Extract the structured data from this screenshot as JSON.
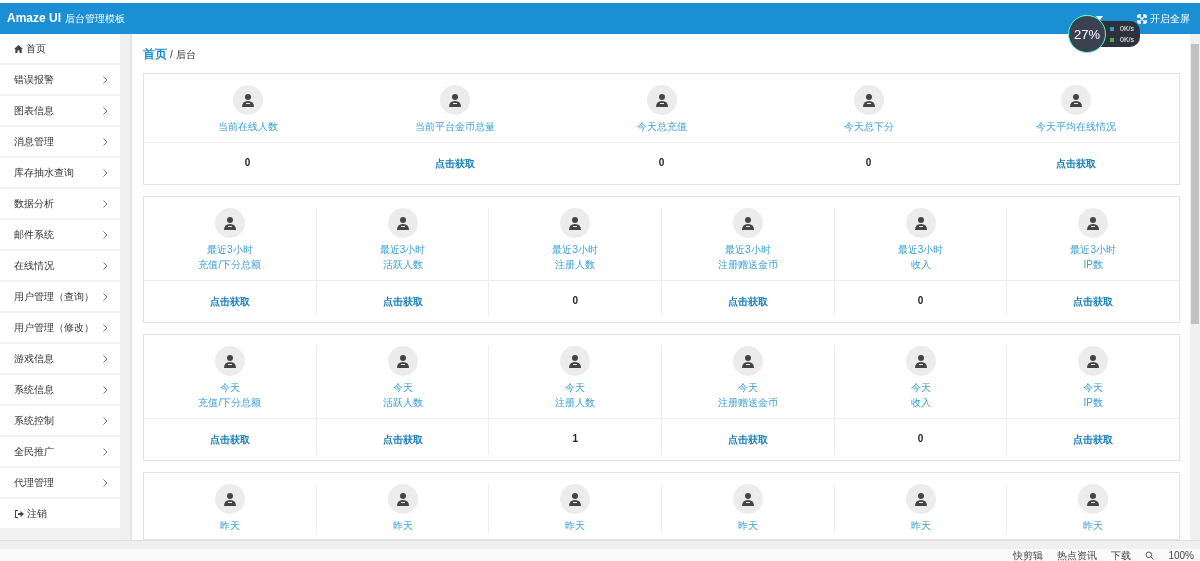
{
  "header": {
    "brand": "Amaze UI",
    "subtitle": "后台管理模板",
    "fullscreen": "开启全屏"
  },
  "speed_widget": {
    "percent": "27%",
    "upload": "0K/s",
    "download": "0K/s"
  },
  "sidebar": {
    "items": [
      {
        "label": "首页",
        "kind": "home",
        "selected": false
      },
      {
        "label": "错误报警",
        "kind": "menu"
      },
      {
        "label": "图表信息",
        "kind": "menu"
      },
      {
        "label": "消息管理",
        "kind": "menu"
      },
      {
        "label": "库存抽水查询",
        "kind": "menu"
      },
      {
        "label": "数据分析",
        "kind": "menu"
      },
      {
        "label": "邮件系统",
        "kind": "menu"
      },
      {
        "label": "在线情况",
        "kind": "menu"
      },
      {
        "label": "用户管理（查询）",
        "kind": "menu"
      },
      {
        "label": "用户管理（修改）",
        "kind": "menu"
      },
      {
        "label": "游戏信息",
        "kind": "menu"
      },
      {
        "label": "系统信息",
        "kind": "menu"
      },
      {
        "label": "系统控制",
        "kind": "menu"
      },
      {
        "label": "全民推广",
        "kind": "menu"
      },
      {
        "label": "代理管理",
        "kind": "menu"
      },
      {
        "label": "注销",
        "kind": "logout"
      }
    ]
  },
  "breadcrumb": {
    "current": "首页",
    "parent": "/ 后台"
  },
  "sections": [
    {
      "cards": [
        {
          "lines": [
            "当前在线人数"
          ],
          "value": {
            "kind": "number",
            "text": "0"
          }
        },
        {
          "lines": [
            "当前平台金币总量"
          ],
          "value": {
            "kind": "link",
            "text": "点击获取"
          }
        },
        {
          "lines": [
            "今天总充值"
          ],
          "value": {
            "kind": "number",
            "text": "0"
          }
        },
        {
          "lines": [
            "今天总下分"
          ],
          "value": {
            "kind": "number",
            "text": "0"
          }
        },
        {
          "lines": [
            "今天平均在线情况"
          ],
          "value": {
            "kind": "link",
            "text": "点击获取"
          }
        }
      ]
    },
    {
      "cards": [
        {
          "lines": [
            "最近3小时",
            "充值/下分总额"
          ],
          "value": {
            "kind": "link",
            "text": "点击获取"
          }
        },
        {
          "lines": [
            "最近3小时",
            "活跃人数"
          ],
          "value": {
            "kind": "link",
            "text": "点击获取"
          }
        },
        {
          "lines": [
            "最近3小时",
            "注册人数"
          ],
          "value": {
            "kind": "number",
            "text": "0"
          }
        },
        {
          "lines": [
            "最近3小时",
            "注册赠送金币"
          ],
          "value": {
            "kind": "link",
            "text": "点击获取"
          }
        },
        {
          "lines": [
            "最近3小时",
            "收入"
          ],
          "value": {
            "kind": "number",
            "text": "0"
          }
        },
        {
          "lines": [
            "最近3小时",
            "IP数"
          ],
          "value": {
            "kind": "link",
            "text": "点击获取"
          }
        }
      ]
    },
    {
      "cards": [
        {
          "lines": [
            "今天",
            "充值/下分总额"
          ],
          "value": {
            "kind": "link",
            "text": "点击获取"
          }
        },
        {
          "lines": [
            "今天",
            "活跃人数"
          ],
          "value": {
            "kind": "link",
            "text": "点击获取"
          }
        },
        {
          "lines": [
            "今天",
            "注册人数"
          ],
          "value": {
            "kind": "number",
            "text": "1"
          }
        },
        {
          "lines": [
            "今天",
            "注册赠送金币"
          ],
          "value": {
            "kind": "link",
            "text": "点击获取"
          }
        },
        {
          "lines": [
            "今天",
            "收入"
          ],
          "value": {
            "kind": "number",
            "text": "0"
          }
        },
        {
          "lines": [
            "今天",
            "IP数"
          ],
          "value": {
            "kind": "link",
            "text": "点击获取"
          }
        }
      ]
    },
    {
      "cards": [
        {
          "lines": [
            "昨天"
          ]
        },
        {
          "lines": [
            "昨天"
          ]
        },
        {
          "lines": [
            "昨天"
          ]
        },
        {
          "lines": [
            "昨天"
          ]
        },
        {
          "lines": [
            "昨天"
          ]
        },
        {
          "lines": [
            "昨天"
          ]
        }
      ]
    }
  ],
  "status_bar": {
    "items": [
      "快剪辑",
      "热点资讯",
      "下载"
    ],
    "zoom": "100%"
  }
}
